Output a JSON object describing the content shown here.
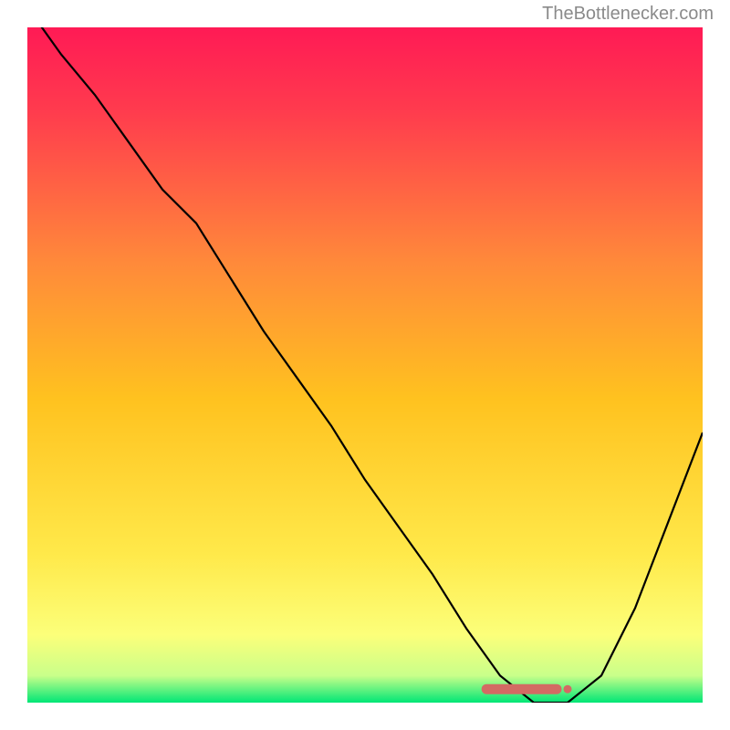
{
  "watermark": "TheBottlenecker.com",
  "chart_data": {
    "type": "line",
    "title": "",
    "xlabel": "",
    "ylabel": "",
    "xlim": [
      0,
      100
    ],
    "ylim": [
      0,
      100
    ],
    "background_gradient": {
      "top": "#ff1a55",
      "mid": "#ffd000",
      "near_bottom": "#ffff66",
      "bottom": "#00e676"
    },
    "series": [
      {
        "name": "bottleneck-curve",
        "x": [
          0,
          5,
          10,
          15,
          20,
          25,
          30,
          35,
          40,
          45,
          50,
          55,
          60,
          65,
          70,
          75,
          80,
          85,
          90,
          95,
          100
        ],
        "y": [
          103,
          96,
          90,
          83,
          76,
          71,
          63,
          55,
          48,
          41,
          33,
          26,
          19,
          11,
          4,
          0,
          0,
          4,
          14,
          27,
          40
        ]
      }
    ],
    "marker": {
      "name": "highlight-range",
      "x_start": 68,
      "x_end": 80,
      "y": 2,
      "color": "#d36a63"
    }
  }
}
